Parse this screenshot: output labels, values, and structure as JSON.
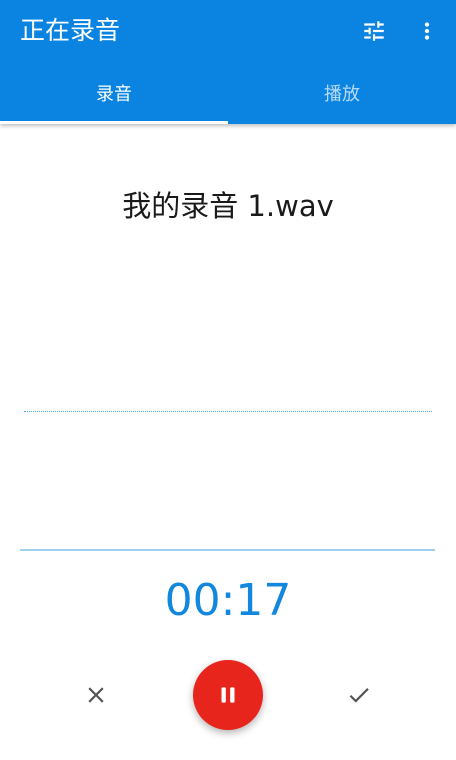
{
  "appbar": {
    "title": "正在录音",
    "tune_icon": "tune-icon",
    "more_icon": "more-vert-icon"
  },
  "tabs": [
    {
      "label": "录音",
      "active": true
    },
    {
      "label": "播放",
      "active": false
    }
  ],
  "recording": {
    "filename": "我的录音 1.wav",
    "elapsed": "00:17"
  },
  "controls": {
    "cancel_icon": "close-icon",
    "pause_icon": "pause-icon",
    "confirm_icon": "check-icon"
  },
  "colors": {
    "primary": "#0a84e0",
    "accent_red": "#e8251d",
    "timer_blue": "#1187dd"
  }
}
